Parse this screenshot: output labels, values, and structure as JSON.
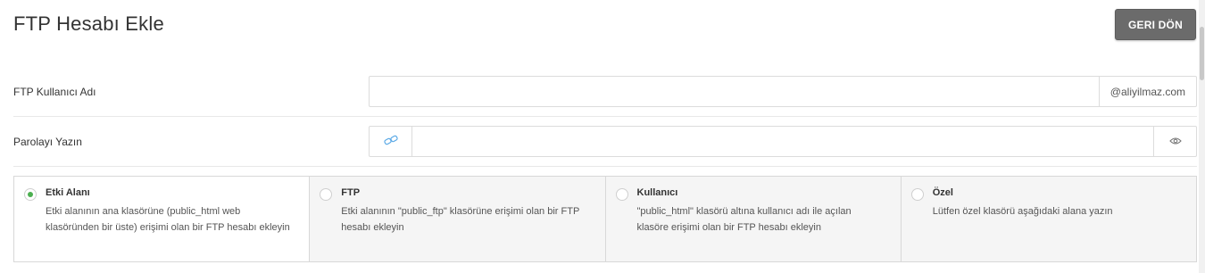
{
  "page": {
    "title": "FTP Hesabı Ekle",
    "back_label": "GERI DÖN"
  },
  "username_row": {
    "label": "FTP Kullanıcı Adı",
    "value": "",
    "domain_suffix": "@aliyilmaz.com"
  },
  "password_row": {
    "label": "Parolayı Yazın",
    "value": "",
    "generate_icon": "link-icon",
    "toggle_icon": "eye-icon"
  },
  "directory_options": [
    {
      "title": "Etki Alanı",
      "description": "Etki alanının ana klasörüne (public_html web klasöründen bir üste) erişimi olan bir FTP hesabı ekleyin",
      "selected": true
    },
    {
      "title": "FTP",
      "description": "Etki alanının \"public_ftp\" klasörüne erişimi olan bir FTP hesabı ekleyin",
      "selected": false
    },
    {
      "title": "Kullanıcı",
      "description": "\"public_html\" klasörü altına kullanıcı adı ile açılan klasöre erişimi olan bir FTP hesabı ekleyin",
      "selected": false
    },
    {
      "title": "Özel",
      "description": "Lütfen özel klasörü aşağıdaki alana yazın",
      "selected": false
    }
  ],
  "colors": {
    "button_bg": "#6b6b6b",
    "radio_selected": "#4caf50",
    "icon_blue": "#5aa9e6"
  }
}
